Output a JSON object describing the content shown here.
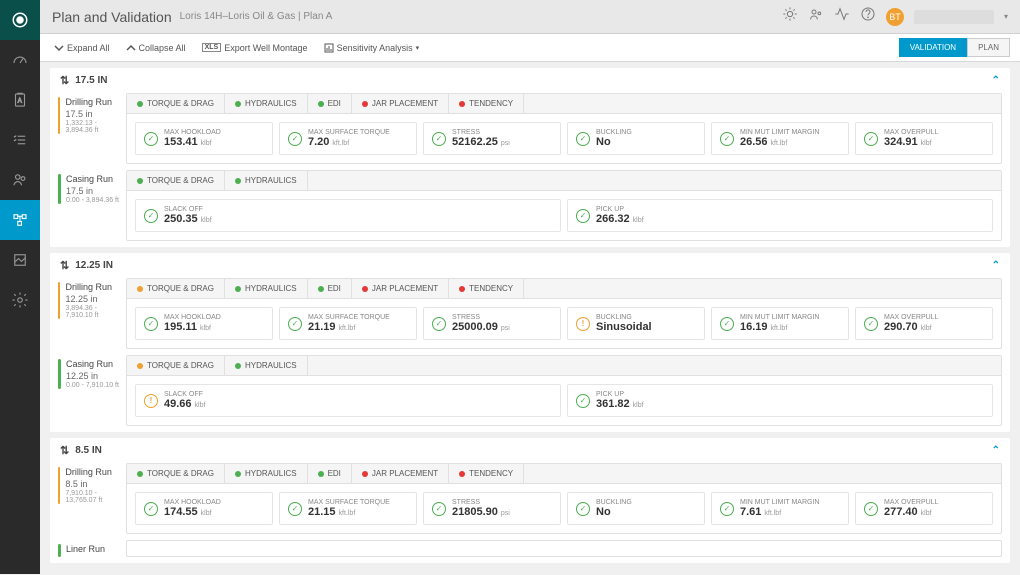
{
  "header": {
    "title": "Plan and Validation",
    "breadcrumb": "Loris 14H–Loris Oil & Gas | Plan A",
    "avatar": "BT"
  },
  "toolbar": {
    "expand_all": "Expand All",
    "collapse_all": "Collapse All",
    "export": "Export Well Montage",
    "sensitivity": "Sensitivity Analysis",
    "validation": "VALIDATION",
    "plan": "PLAN"
  },
  "sections": [
    {
      "title": "17.5 IN",
      "runs": [
        {
          "bar": "orange",
          "title": "Drilling Run",
          "size": "17.5 in",
          "range": "1,332.13 - 3,894.36 ft",
          "tabs": [
            {
              "dot": "green",
              "label": "TORQUE & DRAG"
            },
            {
              "dot": "green",
              "label": "HYDRAULICS"
            },
            {
              "dot": "green",
              "label": "EDI"
            },
            {
              "dot": "red",
              "label": "JAR PLACEMENT"
            },
            {
              "dot": "red",
              "label": "TENDENCY"
            }
          ],
          "metrics": [
            {
              "icon": "ok",
              "label": "MAX HOOKLOAD",
              "value": "153.41",
              "unit": "klbf"
            },
            {
              "icon": "ok",
              "label": "MAX SURFACE TORQUE",
              "value": "7.20",
              "unit": "kft.lbf"
            },
            {
              "icon": "ok",
              "label": "STRESS",
              "value": "52162.25",
              "unit": "psi"
            },
            {
              "icon": "ok",
              "label": "BUCKLING",
              "value": "No",
              "unit": ""
            },
            {
              "icon": "ok",
              "label": "MIN MUT LIMIT MARGIN",
              "value": "26.56",
              "unit": "kft.lbf"
            },
            {
              "icon": "ok",
              "label": "MAX OVERPULL",
              "value": "324.91",
              "unit": "klbf"
            }
          ]
        },
        {
          "bar": "green",
          "title": "Casing Run",
          "size": "17.5 in",
          "range": "0.00 - 3,894.36 ft",
          "tabs": [
            {
              "dot": "green",
              "label": "TORQUE & DRAG"
            },
            {
              "dot": "green",
              "label": "HYDRAULICS"
            }
          ],
          "metrics": [
            {
              "icon": "ok",
              "label": "SLACK OFF",
              "value": "250.35",
              "unit": "klbf"
            },
            {
              "icon": "ok",
              "label": "PICK UP",
              "value": "266.32",
              "unit": "klbf"
            }
          ]
        }
      ]
    },
    {
      "title": "12.25 IN",
      "runs": [
        {
          "bar": "orange",
          "title": "Drilling Run",
          "size": "12.25 in",
          "range": "3,894.36 - 7,910.10 ft",
          "tabs": [
            {
              "dot": "orange",
              "label": "TORQUE & DRAG"
            },
            {
              "dot": "green",
              "label": "HYDRAULICS"
            },
            {
              "dot": "green",
              "label": "EDI"
            },
            {
              "dot": "red",
              "label": "JAR PLACEMENT"
            },
            {
              "dot": "red",
              "label": "TENDENCY"
            }
          ],
          "metrics": [
            {
              "icon": "ok",
              "label": "MAX HOOKLOAD",
              "value": "195.11",
              "unit": "klbf"
            },
            {
              "icon": "ok",
              "label": "MAX SURFACE TORQUE",
              "value": "21.19",
              "unit": "kft.lbf"
            },
            {
              "icon": "ok",
              "label": "STRESS",
              "value": "25000.09",
              "unit": "psi"
            },
            {
              "icon": "warn",
              "label": "BUCKLING",
              "value": "Sinusoidal",
              "unit": ""
            },
            {
              "icon": "ok",
              "label": "MIN MUT LIMIT MARGIN",
              "value": "16.19",
              "unit": "kft.lbf"
            },
            {
              "icon": "ok",
              "label": "MAX OVERPULL",
              "value": "290.70",
              "unit": "klbf"
            }
          ]
        },
        {
          "bar": "green",
          "title": "Casing Run",
          "size": "12.25 in",
          "range": "0.00 - 7,910.10 ft",
          "tabs": [
            {
              "dot": "orange",
              "label": "TORQUE & DRAG"
            },
            {
              "dot": "green",
              "label": "HYDRAULICS"
            }
          ],
          "metrics": [
            {
              "icon": "warn",
              "label": "SLACK OFF",
              "value": "49.66",
              "unit": "klbf"
            },
            {
              "icon": "ok",
              "label": "PICK UP",
              "value": "361.82",
              "unit": "klbf"
            }
          ]
        }
      ]
    },
    {
      "title": "8.5 IN",
      "runs": [
        {
          "bar": "orange",
          "title": "Drilling Run",
          "size": "8.5 in",
          "range": "7,910.10 - 13,765.07 ft",
          "tabs": [
            {
              "dot": "green",
              "label": "TORQUE & DRAG"
            },
            {
              "dot": "green",
              "label": "HYDRAULICS"
            },
            {
              "dot": "green",
              "label": "EDI"
            },
            {
              "dot": "red",
              "label": "JAR PLACEMENT"
            },
            {
              "dot": "red",
              "label": "TENDENCY"
            }
          ],
          "metrics": [
            {
              "icon": "ok",
              "label": "MAX HOOKLOAD",
              "value": "174.55",
              "unit": "klbf"
            },
            {
              "icon": "ok",
              "label": "MAX SURFACE TORQUE",
              "value": "21.15",
              "unit": "kft.lbf"
            },
            {
              "icon": "ok",
              "label": "STRESS",
              "value": "21805.90",
              "unit": "psi"
            },
            {
              "icon": "ok",
              "label": "BUCKLING",
              "value": "No",
              "unit": ""
            },
            {
              "icon": "ok",
              "label": "MIN MUT LIMIT MARGIN",
              "value": "7.61",
              "unit": "kft.lbf"
            },
            {
              "icon": "ok",
              "label": "MAX OVERPULL",
              "value": "277.40",
              "unit": "klbf"
            }
          ]
        },
        {
          "bar": "green",
          "title": "Liner Run",
          "size": "",
          "range": "",
          "tabs": [],
          "metrics": []
        }
      ]
    }
  ]
}
